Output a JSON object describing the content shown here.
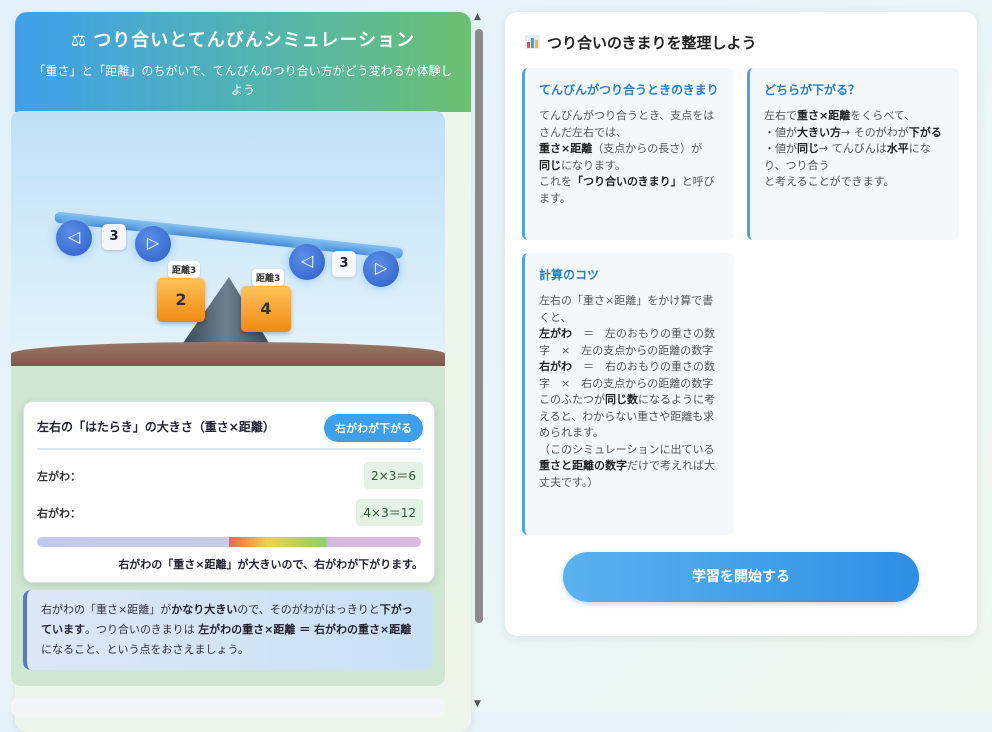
{
  "header": {
    "title": "つり合いとてんびんシミュレーション",
    "subtitle": "「重さ」と「距離」のちがいで、てんびんのつり合い方がどう変わるか体験しよう"
  },
  "simulation": {
    "left_distance": "3",
    "right_distance": "3",
    "left_weight": "2",
    "right_weight": "4",
    "left_tag": "距離3",
    "right_tag": "距離3"
  },
  "work_card": {
    "title": "左右の「はたらき」の大きさ（重さ×距離）",
    "badge": "右がわが下がる",
    "left_label": "左がわ：",
    "left_value": "2×3＝6",
    "right_label": "右がわ：",
    "right_value": "4×3＝12",
    "note": "右がわの「重さ×距離」が大きいので、右がわが下がります。"
  },
  "explain": {
    "t1": "右がわの「重さ×距離」が",
    "b1": "かなり大きい",
    "t2": "ので、そのがわがはっきりと",
    "b2": "下がっています",
    "t3": "。つり合いのきまりは",
    "b3": "左がわの重さ×距離 ＝ 右がわの重さ×距離",
    "t4": "になること、という点をおさえましょう。"
  },
  "right_panel": {
    "title": "つり合いのきまりを整理しよう",
    "card1": {
      "title": "てんびんがつり合うときのきまり",
      "l1": "てんびんがつり合うとき、支点をはさんだ左右では、",
      "l2b": "重さ×距離",
      "l2": "（支点からの長さ）が",
      "l3b": "同じ",
      "l3": "になります。",
      "l4a": "これを",
      "l4b": "「つり合いのきまり」",
      "l4c": "と呼びます。"
    },
    "card2": {
      "title": "どちらが下がる？",
      "l1a": "左右で",
      "l1b": "重さ×距離",
      "l1c": "をくらべて、",
      "l2a": "・値が",
      "l2b": "大きい方",
      "l2c": "→ そのがわが",
      "l2d": "下がる",
      "l3a": "・値が",
      "l3b": "同じ",
      "l3c": "→ てんびんは",
      "l3d": "水平",
      "l3e": "になり、つり合う",
      "l4": "と考えることができます。"
    },
    "card3": {
      "title": "計算のコツ",
      "l1": "左右の「重さ×距離」をかけ算で書くと、",
      "l2b": "左がわ",
      "l2": "＝　左のおもりの重さの数字　×　左の支点からの距離の数字",
      "l3b": "右がわ",
      "l3": "＝　右のおもりの重さの数字　×　右の支点からの距離の数字",
      "l4a": "このふたつが",
      "l4b": "同じ数",
      "l4c": "になるように考えると、わからない重さや距離も求められます。",
      "l5a": "（このシミュレーションに出ている",
      "l5b": "重さと距離の数字",
      "l5c": "だけで考えれば大丈夫です。）"
    },
    "start_button": "学習を開始する"
  },
  "colors": {
    "accent": "#3f9fe8",
    "weight": "#f7a21c",
    "header_start": "#3ea0ea",
    "header_end": "#6cbf72"
  },
  "icons": [
    "balance-scale-icon",
    "bar-chart-icon",
    "arrow-left-icon",
    "arrow-right-icon"
  ]
}
